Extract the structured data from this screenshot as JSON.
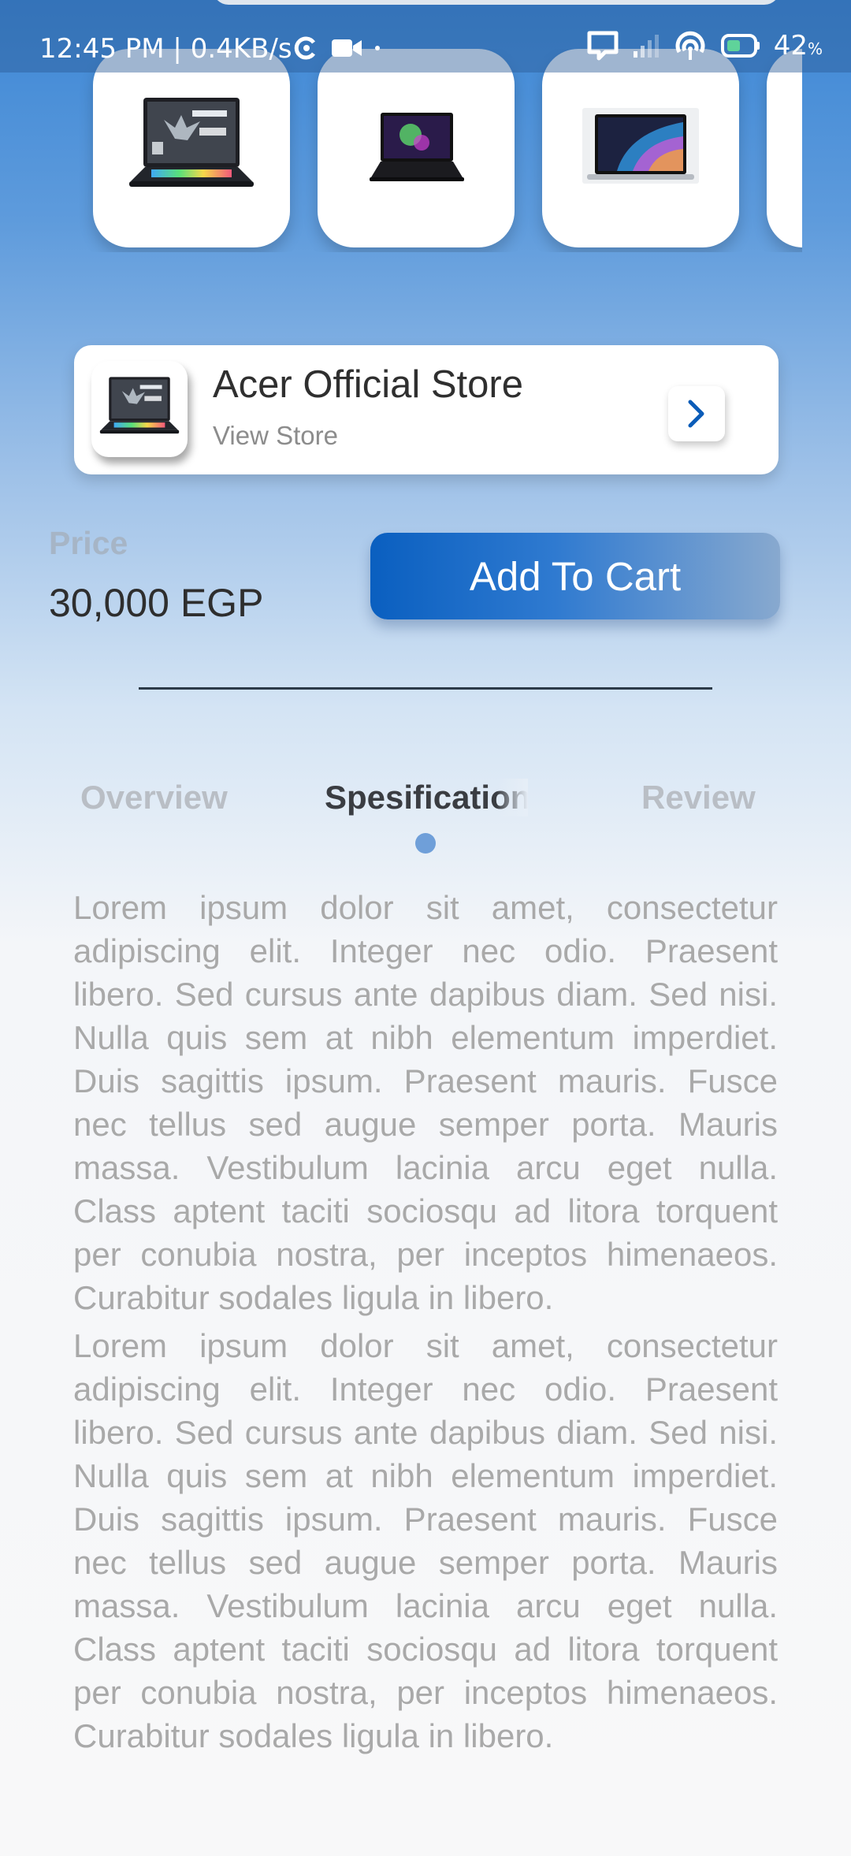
{
  "status_bar": {
    "time_speed": "12:45 PM | 0.4KB/s",
    "battery": "42",
    "battery_unit": "%"
  },
  "product_thumbnails": [
    {
      "icon": "laptop-predator-thumbnail"
    },
    {
      "icon": "laptop-razer-thumbnail"
    },
    {
      "icon": "laptop-macbook-thumbnail"
    }
  ],
  "store": {
    "name": "Acer Official Store",
    "subtitle": "View Store",
    "arrow_icon": "chevron-right-icon",
    "arrow_color": "#0b5cb8"
  },
  "price": {
    "label": "Price",
    "value": "30,000 EGP"
  },
  "cart": {
    "label": "Add To Cart",
    "accent": "#0a5fc0"
  },
  "tabs": [
    {
      "label": "Overview",
      "active": false
    },
    {
      "label": "Spesification",
      "active": true
    },
    {
      "label": "Review",
      "active": false
    }
  ],
  "description": [
    "Lorem ipsum dolor sit amet, consectetur adipiscing elit. Integer nec odio. Praesent libero. Sed cursus ante dapibus diam. Sed nisi. Nulla quis sem at nibh elementum imperdiet. Duis sagittis ipsum. Praesent mauris. Fusce nec tellus sed augue semper porta. Mauris massa. Vestibulum lacinia arcu eget nulla. Class aptent taciti sociosqu ad litora torquent per conubia nostra, per inceptos himenaeos. Curabitur sodales ligula in libero.",
    "Lorem ipsum dolor sit amet, consectetur adipiscing elit. Integer nec odio. Praesent libero. Sed cursus ante dapibus diam. Sed nisi. Nulla quis sem at nibh elementum imperdiet. Duis sagittis ipsum. Praesent mauris. Fusce nec tellus sed augue semper porta. Mauris massa. Vestibulum lacinia arcu eget nulla. Class aptent taciti sociosqu ad litora torquent per conubia nostra, per inceptos himenaeos. Curabitur sodales ligula in libero."
  ]
}
